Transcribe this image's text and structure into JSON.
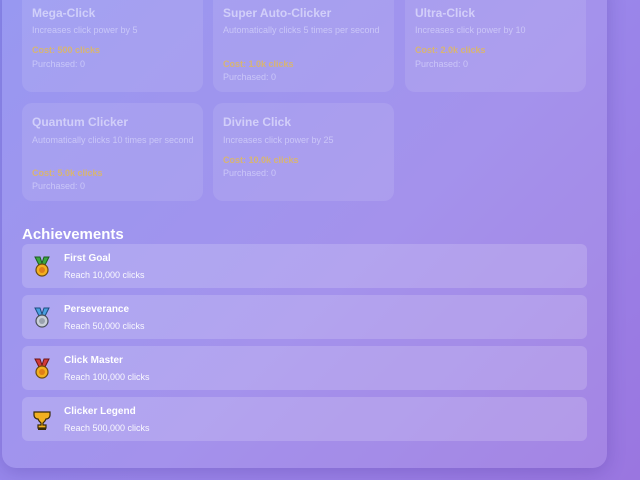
{
  "upgrades": [
    {
      "title": "Mega-Click",
      "desc": "Increases click power by 5",
      "cost": "Cost: 500 clicks",
      "purchased": "Purchased: 0"
    },
    {
      "title": "Super Auto-Clicker",
      "desc": "Automatically clicks 5 times per second",
      "cost": "Cost: 1.0k clicks",
      "purchased": "Purchased: 0"
    },
    {
      "title": "Ultra-Click",
      "desc": "Increases click power by 10",
      "cost": "Cost: 2.0k clicks",
      "purchased": "Purchased: 0"
    },
    {
      "title": "Quantum Clicker",
      "desc": "Automatically clicks 10 times per second",
      "cost": "Cost: 5.0k clicks",
      "purchased": "Purchased: 0"
    },
    {
      "title": "Divine Click",
      "desc": "Increases click power by 25",
      "cost": "Cost: 10.0k clicks",
      "purchased": "Purchased: 0"
    }
  ],
  "achievements": {
    "heading": "Achievements",
    "items": [
      {
        "title": "First Goal",
        "desc": "Reach 10,000 clicks",
        "icon": "medal-green-icon"
      },
      {
        "title": "Perseverance",
        "desc": "Reach 50,000 clicks",
        "icon": "medal-blue-icon"
      },
      {
        "title": "Click Master",
        "desc": "Reach 100,000 clicks",
        "icon": "medal-red-icon"
      },
      {
        "title": "Clicker Legend",
        "desc": "Reach 500,000 clicks",
        "icon": "trophy-icon"
      }
    ]
  },
  "colors": {
    "cost": "#e8bc48",
    "medal_green": "#3aa640",
    "medal_blue": "#4a9fe0",
    "medal_red": "#d23a3a",
    "gold": "#f2b020"
  }
}
